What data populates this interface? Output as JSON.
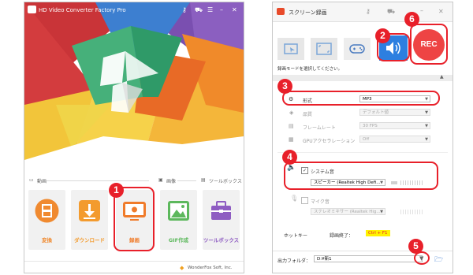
{
  "colors": {
    "accent": "#e8202a",
    "rec_red": "#ee4444",
    "active_tab": "#2d7fe0",
    "purple": "#8e5cc2"
  },
  "left_app": {
    "title": "HD Video Converter Factory Pro",
    "window_controls": [
      "key-icon",
      "cart-icon",
      "list-icon",
      "minimize-icon",
      "close-icon"
    ],
    "categories": [
      {
        "icon": "video-category-icon",
        "label": "動画"
      },
      {
        "icon": "image-category-icon",
        "label": "画像"
      },
      {
        "icon": "toolbox-category-icon",
        "label": "ツールボックス"
      }
    ],
    "tools": [
      {
        "label": "変換",
        "icon": "film-convert-icon",
        "color": "#f08a30"
      },
      {
        "label": "ダウンロード",
        "icon": "download-icon",
        "color": "#f39b2e"
      },
      {
        "label": "録画",
        "icon": "screen-record-icon",
        "color": "#f07b2a"
      },
      {
        "label": "GIF作成",
        "icon": "gif-image-icon",
        "color": "#5cb85c"
      },
      {
        "label": "ツールボックス",
        "icon": "toolbox-icon",
        "color": "#8e5cc2"
      }
    ],
    "footer": "WonderFox Soft, Inc."
  },
  "right_app": {
    "title": "スクリーン録画",
    "window_controls": [
      "key-icon",
      "cart-icon",
      "minimize-icon",
      "close-icon"
    ],
    "mode_tabs": [
      "window-capture-icon",
      "fullscreen-capture-icon",
      "game-capture-icon",
      "audio-capture-icon"
    ],
    "rec_label": "REC",
    "mode_hint": "録画モードを選択してください。",
    "settings": [
      {
        "icon": "format-icon",
        "label": "形式",
        "value": "MP3",
        "enabled": true
      },
      {
        "icon": "quality-icon",
        "label": "品質",
        "value": "デフォルト値",
        "enabled": false
      },
      {
        "icon": "framerate-icon",
        "label": "フレームレート",
        "value": "30 FPS",
        "enabled": false
      },
      {
        "icon": "gpu-icon",
        "label": "GPUアクセラレーション",
        "value": "Off",
        "enabled": false
      }
    ],
    "audio": {
      "system_label": "システム音",
      "system_checked": true,
      "system_device": "スピーカー (Realtek High Defi...",
      "mic_label": "マイク音",
      "mic_checked": false,
      "mic_device": "ステレオミキサー (Realtek Hig..."
    },
    "hotkey": {
      "label": "ホットキー",
      "action": "録画終了：",
      "key": "Ctrl + F1"
    },
    "output": {
      "label": "出力フォルダ：",
      "path": "D:¥新1"
    }
  },
  "callouts": [
    "1",
    "2",
    "3",
    "4",
    "5",
    "6"
  ]
}
